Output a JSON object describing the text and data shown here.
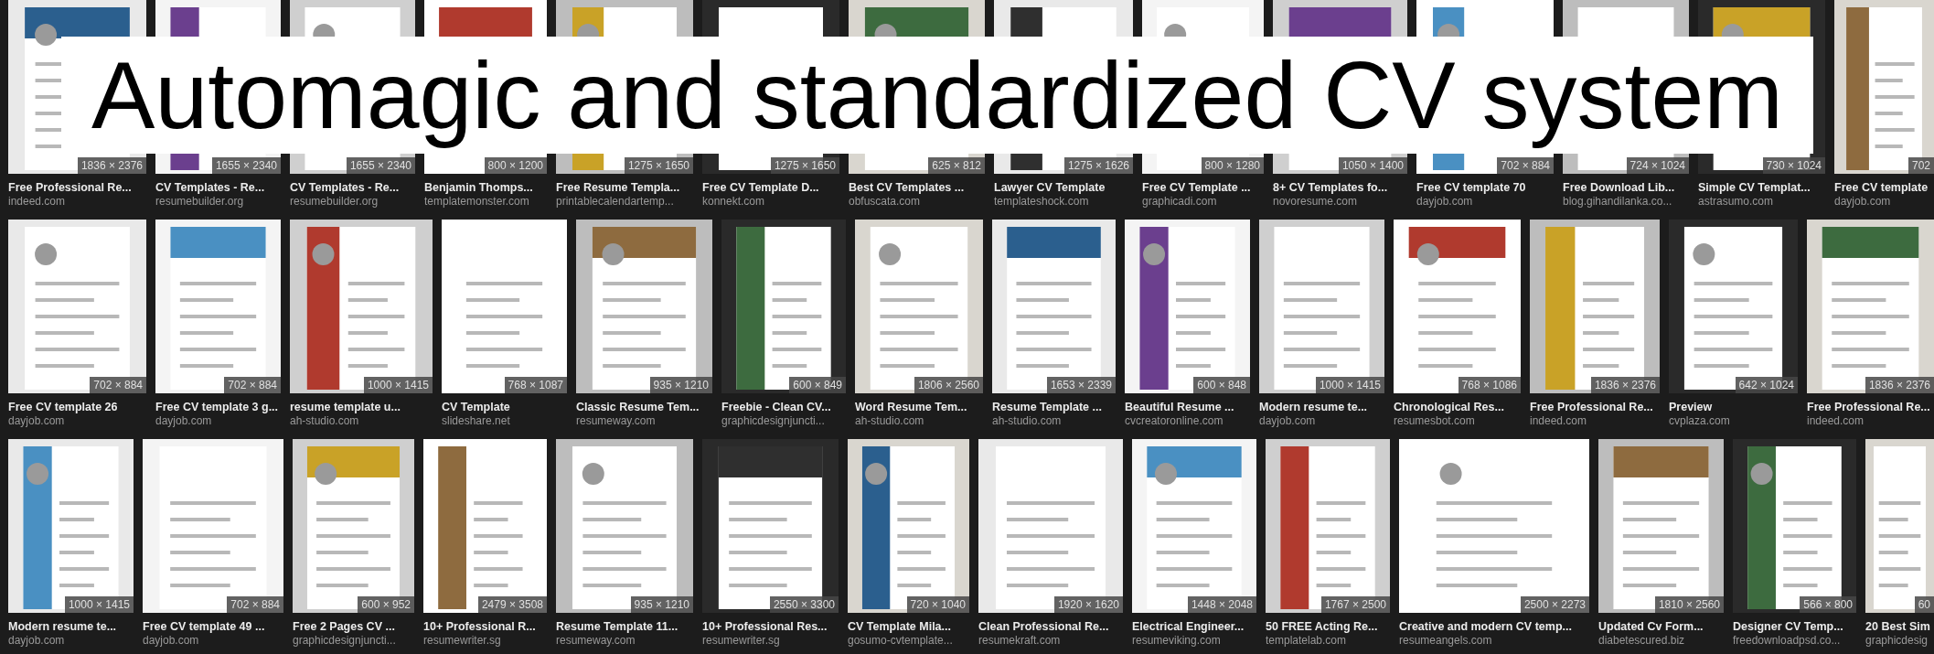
{
  "headline": "Automagic and standardized CV system",
  "rows": [
    [
      {
        "dimensions": "1836 × 2376",
        "title": "Free Professional Re...",
        "source": "indeed.com"
      },
      {
        "dimensions": "1655 × 2340",
        "title": "CV Templates - Re...",
        "source": "resumebuilder.org"
      },
      {
        "dimensions": "1655 × 2340",
        "title": "CV Templates - Re...",
        "source": "resumebuilder.org"
      },
      {
        "dimensions": "800 × 1200",
        "title": "Benjamin Thomps...",
        "source": "templatemonster.com"
      },
      {
        "dimensions": "1275 × 1650",
        "title": "Free Resume Templa...",
        "source": "printablecalendartemp..."
      },
      {
        "dimensions": "1275 × 1650",
        "title": "Free CV Template D...",
        "source": "konnekt.com"
      },
      {
        "dimensions": "625 × 812",
        "title": "Best CV Templates ...",
        "source": "obfuscata.com"
      },
      {
        "dimensions": "1275 × 1626",
        "title": "Lawyer CV Template",
        "source": "templateshock.com"
      },
      {
        "dimensions": "800 × 1280",
        "title": "Free CV Template ...",
        "source": "graphicadi.com"
      },
      {
        "dimensions": "1050 × 1400",
        "title": "8+ CV Templates fo...",
        "source": "novoresume.com"
      },
      {
        "dimensions": "702 × 884",
        "title": "Free CV template 70",
        "source": "dayjob.com"
      },
      {
        "dimensions": "724 × 1024",
        "title": "Free Download Lib...",
        "source": "blog.gihandilanka.co..."
      },
      {
        "dimensions": "730 × 1024",
        "title": "Simple CV Templat...",
        "source": "astrasumo.com"
      },
      {
        "dimensions": "702",
        "title": "Free CV template",
        "source": "dayjob.com"
      }
    ],
    [
      {
        "dimensions": "702 × 884",
        "title": "Free CV template 26",
        "source": "dayjob.com"
      },
      {
        "dimensions": "702 × 884",
        "title": "Free CV template 3 g...",
        "source": "dayjob.com"
      },
      {
        "dimensions": "1000 × 1415",
        "title": "resume template u...",
        "source": "ah-studio.com"
      },
      {
        "dimensions": "768 × 1087",
        "title": "CV Template",
        "source": "slideshare.net"
      },
      {
        "dimensions": "935 × 1210",
        "title": "Classic Resume Tem...",
        "source": "resumeway.com"
      },
      {
        "dimensions": "600 × 849",
        "title": "Freebie - Clean CV...",
        "source": "graphicdesignjuncti..."
      },
      {
        "dimensions": "1806 × 2560",
        "title": "Word Resume Tem...",
        "source": "ah-studio.com"
      },
      {
        "dimensions": "1653 × 2339",
        "title": "Resume Template ...",
        "source": "ah-studio.com"
      },
      {
        "dimensions": "600 × 848",
        "title": "Beautiful Resume ...",
        "source": "cvcreatoronline.com"
      },
      {
        "dimensions": "1000 × 1415",
        "title": "Modern resume te...",
        "source": "dayjob.com"
      },
      {
        "dimensions": "768 × 1086",
        "title": "Chronological Res...",
        "source": "resumesbot.com"
      },
      {
        "dimensions": "1836 × 2376",
        "title": "Free Professional Re...",
        "source": "indeed.com"
      },
      {
        "dimensions": "642 × 1024",
        "title": "Preview",
        "source": "cvplaza.com"
      },
      {
        "dimensions": "1836 × 2376",
        "title": "Free Professional Re...",
        "source": "indeed.com"
      }
    ],
    [
      {
        "dimensions": "1000 × 1415",
        "title": "Modern resume te...",
        "source": "dayjob.com"
      },
      {
        "dimensions": "702 × 884",
        "title": "Free CV template 49 ...",
        "source": "dayjob.com"
      },
      {
        "dimensions": "600 × 952",
        "title": "Free 2 Pages CV ...",
        "source": "graphicdesignjuncti..."
      },
      {
        "dimensions": "2479 × 3508",
        "title": "10+ Professional R...",
        "source": "resumewriter.sg"
      },
      {
        "dimensions": "935 × 1210",
        "title": "Resume Template 11...",
        "source": "resumeway.com"
      },
      {
        "dimensions": "2550 × 3300",
        "title": "10+ Professional Res...",
        "source": "resumewriter.sg"
      },
      {
        "dimensions": "720 × 1040",
        "title": "CV Template Mila...",
        "source": "gosumo-cvtemplate..."
      },
      {
        "dimensions": "1920 × 1620",
        "title": "Clean Professional Re...",
        "source": "resumekraft.com"
      },
      {
        "dimensions": "1448 × 2048",
        "title": "Electrical Engineer...",
        "source": "resumeviking.com"
      },
      {
        "dimensions": "1767 × 2500",
        "title": "50 FREE Acting Re...",
        "source": "templatelab.com"
      },
      {
        "dimensions": "2500 × 2273",
        "title": "Creative and modern CV temp...",
        "source": "resumeangels.com"
      },
      {
        "dimensions": "1810 × 2560",
        "title": "Updated Cv Form...",
        "source": "diabetescured.biz"
      },
      {
        "dimensions": "566 × 800",
        "title": "Designer CV Temp...",
        "source": "freedownloadpsd.co..."
      },
      {
        "dimensions": "60",
        "title": "20 Best Sim",
        "source": "graphicdesig"
      }
    ]
  ]
}
